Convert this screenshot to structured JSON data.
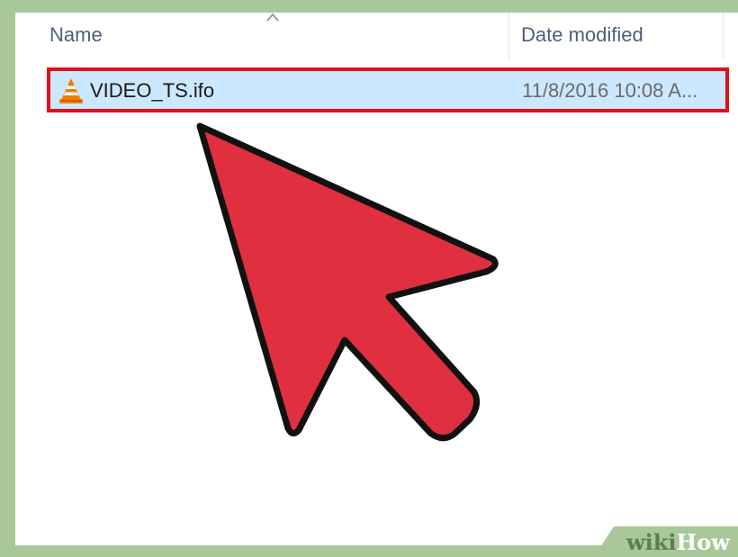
{
  "columns": {
    "name_label": "Name",
    "date_label": "Date modified"
  },
  "file": {
    "icon": "vlc-cone-icon",
    "name": "VIDEO_TS.ifo",
    "date_modified": "11/8/2016 10:08 A..."
  },
  "overlay": {
    "cursor_icon": "red-arrow-cursor-icon",
    "highlight_color": "#e0101a",
    "cursor_color": "#e03040"
  },
  "watermark": {
    "wiki": "wiki",
    "how": "How"
  },
  "colors": {
    "selection": "#cce8ff",
    "frame": "#a9c89a"
  }
}
